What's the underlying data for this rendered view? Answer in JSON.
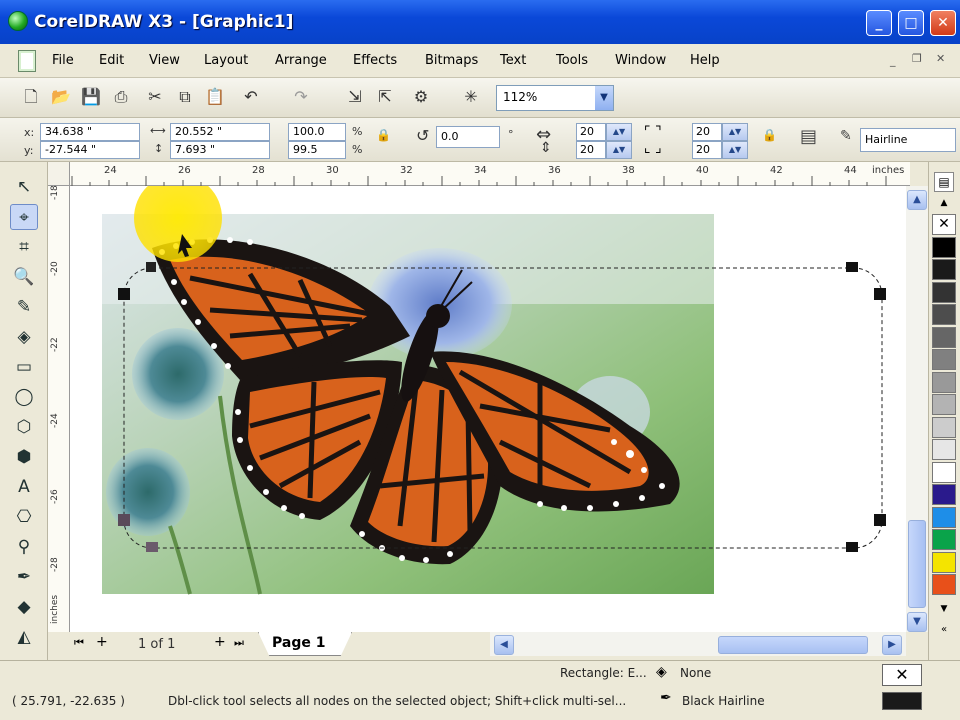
{
  "window": {
    "title": "CorelDRAW X3 - [Graphic1]"
  },
  "menu": [
    "File",
    "Edit",
    "View",
    "Layout",
    "Arrange",
    "Effects",
    "Bitmaps",
    "Text",
    "Tools",
    "Window",
    "Help"
  ],
  "toolbar": {
    "zoom": "112%"
  },
  "property_bar": {
    "x": "34.638 \"",
    "y": "-27.544 \"",
    "width": "20.552 \"",
    "height": "7.693 \"",
    "scale_x": "100.0",
    "scale_y": "99.5",
    "pct_x": "%",
    "pct_y": "%",
    "angle": "0.0",
    "degree": "°",
    "corner_tl": "20",
    "corner_bl": "20",
    "corner_tr": "20",
    "corner_br": "20",
    "outline_width": "Hairline"
  },
  "ruler": {
    "h_labels": [
      "24",
      "26",
      "28",
      "30",
      "32",
      "34",
      "36",
      "38",
      "40",
      "42",
      "44"
    ],
    "h_unit": "inches",
    "v_labels": [
      "-18",
      "-20",
      "-22",
      "-24",
      "-26",
      "-28",
      "-30"
    ],
    "v_unit": "inches"
  },
  "page_nav": {
    "count": "1 of 1",
    "tab": "Page 1"
  },
  "status": {
    "coords": "( 25.791, -22.635 )",
    "hint": "Dbl-click tool selects all nodes on the selected object; Shift+click multi-sel...",
    "object": "Rectangle: E...",
    "fill": "None",
    "outline": "Black  Hairline"
  },
  "palette": [
    "#ffffff",
    "#000000",
    "#1a1a1a",
    "#333333",
    "#4d4d4d",
    "#666666",
    "#808080",
    "#999999",
    "#b3b3b3",
    "#cccccc",
    "#e6e6e6",
    "#ffffff",
    "#2a1a8c",
    "#1e8ee8",
    "#0aa34a",
    "#f4e400",
    "#e8501a"
  ],
  "colors": {
    "titlebar": "#0a48d8",
    "accent": "#2a6cf0",
    "highlight": "#ffe600"
  }
}
